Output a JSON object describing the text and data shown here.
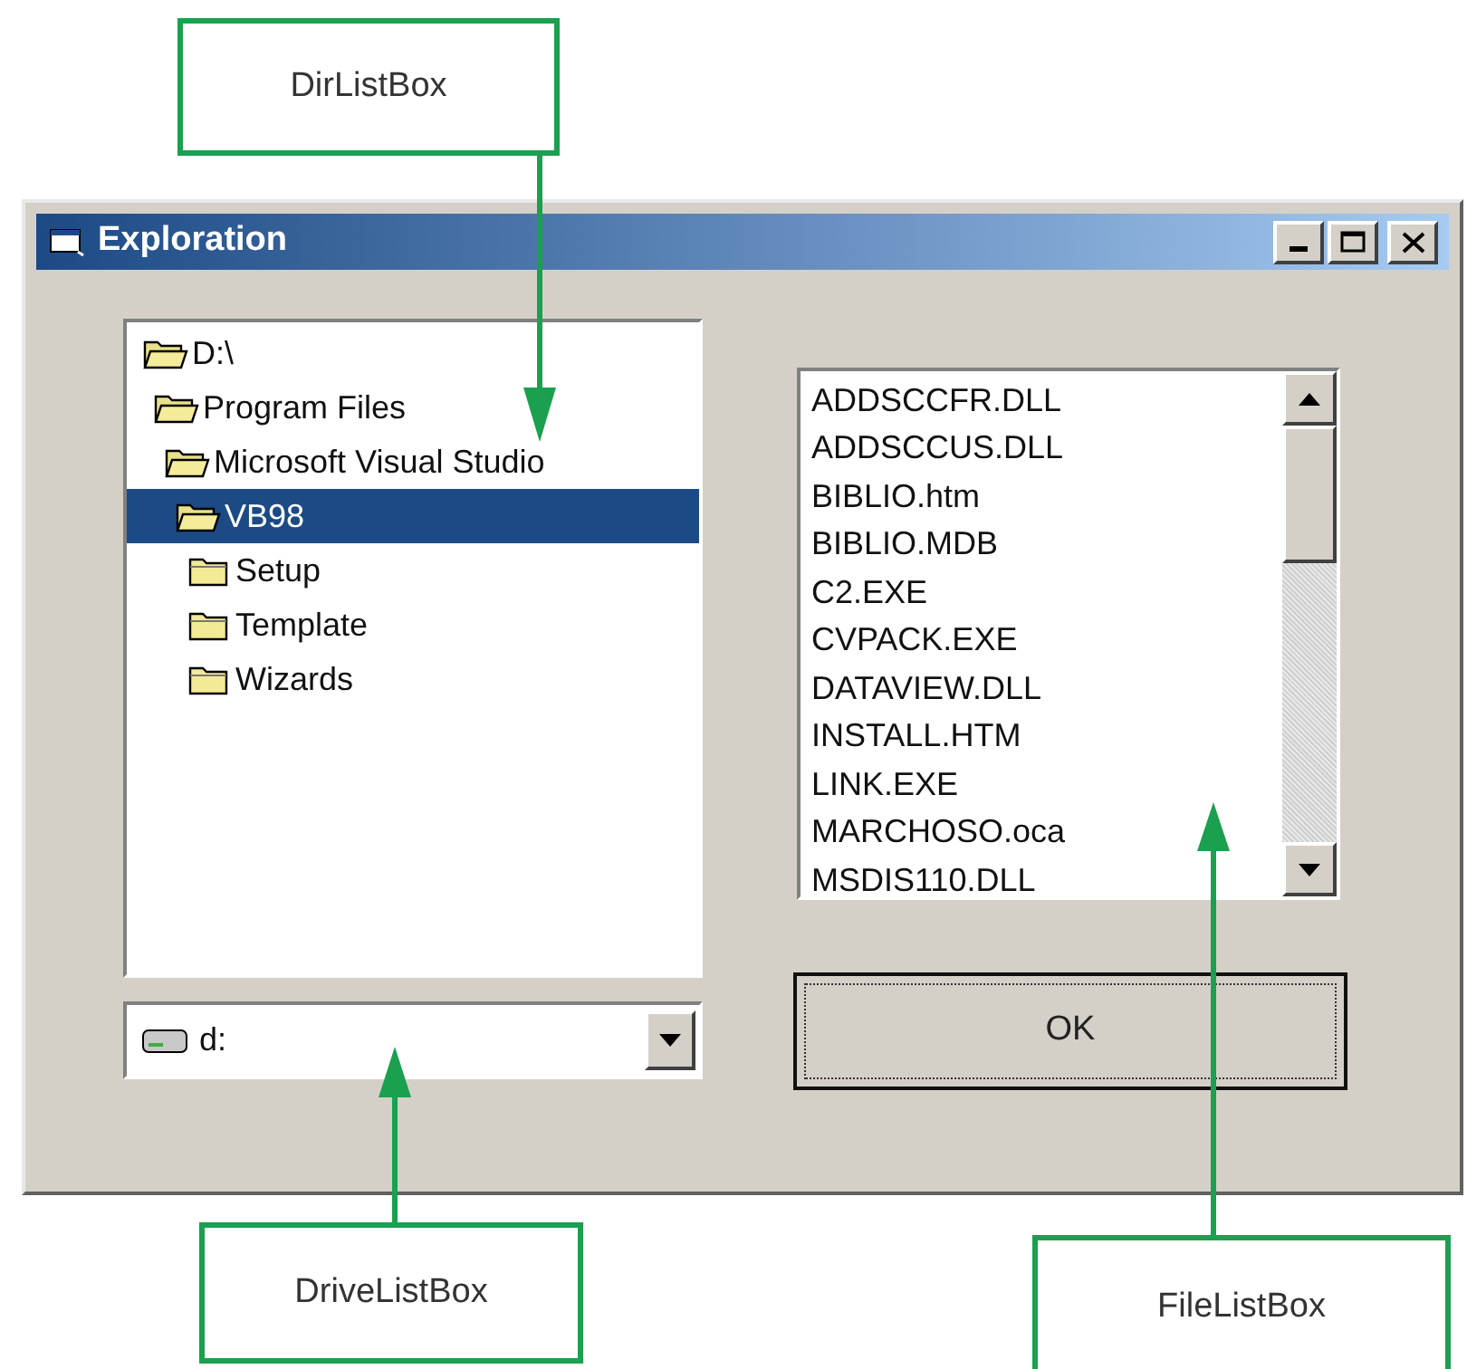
{
  "callouts": {
    "dir": "DirListBox",
    "drive": "DriveListBox",
    "file": "FileListBox"
  },
  "window": {
    "title": "Exploration"
  },
  "dir_tree": [
    {
      "label": "D:\\",
      "expanded": true,
      "selected": false,
      "children": [
        {
          "label": "Program Files",
          "expanded": true,
          "selected": false,
          "children": [
            {
              "label": "Microsoft Visual Studio",
              "expanded": true,
              "selected": false,
              "children": [
                {
                  "label": "VB98",
                  "expanded": true,
                  "selected": true,
                  "children": [
                    {
                      "label": "Setup",
                      "expanded": false,
                      "selected": false
                    },
                    {
                      "label": "Template",
                      "expanded": false,
                      "selected": false
                    },
                    {
                      "label": "Wizards",
                      "expanded": false,
                      "selected": false
                    }
                  ]
                }
              ]
            }
          ]
        }
      ]
    }
  ],
  "drive": {
    "value": "d:"
  },
  "files": [
    "ADDSCCFR.DLL",
    "ADDSCCUS.DLL",
    "BIBLIO.htm",
    "BIBLIO.MDB",
    "C2.EXE",
    "CVPACK.EXE",
    "DATAVIEW.DLL",
    "INSTALL.HTM",
    "LINK.EXE",
    "MARCHOSO.oca",
    "MSDIS110.DLL"
  ],
  "ok_button": "OK"
}
